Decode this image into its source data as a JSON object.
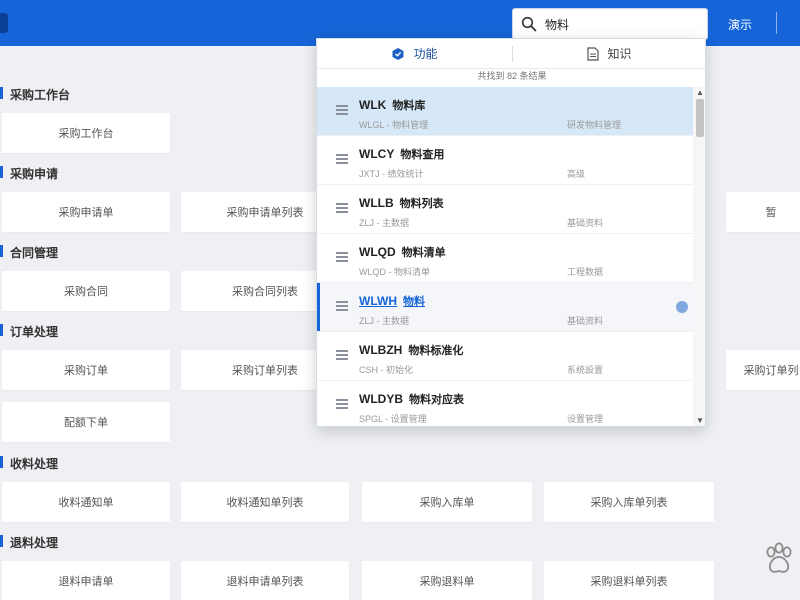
{
  "header": {
    "search_value": "物料",
    "link_label": "演示"
  },
  "sections": [
    {
      "title": "采购工作台",
      "tiles": [
        {
          "label": "采购工作台"
        }
      ]
    },
    {
      "title": "采购申请",
      "tiles": [
        {
          "label": "采购申请单"
        },
        {
          "label": "采购申请单列表"
        },
        {
          "label": "暂"
        }
      ]
    },
    {
      "title": "合同管理",
      "tiles": [
        {
          "label": "采购合同"
        },
        {
          "label": "采购合同列表"
        }
      ]
    },
    {
      "title": "订单处理",
      "tiles": [
        {
          "label": "采购订单"
        },
        {
          "label": "采购订单列表"
        },
        {
          "label": "采购订单列"
        },
        {
          "label": "配额下单"
        }
      ]
    },
    {
      "title": "收料处理",
      "tiles": [
        {
          "label": "收料通知单"
        },
        {
          "label": "收料通知单列表"
        },
        {
          "label": "采购入库单"
        },
        {
          "label": "采购入库单列表"
        }
      ]
    },
    {
      "title": "退料处理",
      "tiles": [
        {
          "label": "退料申请单"
        },
        {
          "label": "退料申请单列表"
        },
        {
          "label": "采购退料单"
        },
        {
          "label": "采购退料单列表"
        }
      ]
    }
  ],
  "dropdown": {
    "tabs": [
      {
        "label": "功能",
        "icon": "function-icon"
      },
      {
        "label": "知识",
        "icon": "document-icon"
      }
    ],
    "result_count": "共找到 82 条结果",
    "items": [
      {
        "code": "WLK",
        "name": "物料库",
        "sub": "WLGL - 物料管理",
        "category": "研发物料管理"
      },
      {
        "code": "WLCY",
        "name": "物料查用",
        "sub": "JXTJ - 绩效统计",
        "category": "高级"
      },
      {
        "code": "WLLB",
        "name": "物料列表",
        "sub": "ZLJ - 主数据",
        "category": "基础资料"
      },
      {
        "code": "WLQD",
        "name": "物料清单",
        "sub": "WLQD - 物料清单",
        "category": "工程数据"
      },
      {
        "code": "WLWH",
        "name": "物料",
        "sub": "ZLJ - 主数据",
        "category": "基础资料"
      },
      {
        "code": "WLBZH",
        "name": "物料标准化",
        "sub": "CSH - 初始化",
        "category": "系统設置"
      },
      {
        "code": "WLDYB",
        "name": "物料对应表",
        "sub": "SPGL - 设置管理",
        "category": "设置管理"
      }
    ]
  },
  "colors": {
    "brand": "#1565d8",
    "highlight": "#d6e8f7",
    "background": "#eef0f3"
  }
}
